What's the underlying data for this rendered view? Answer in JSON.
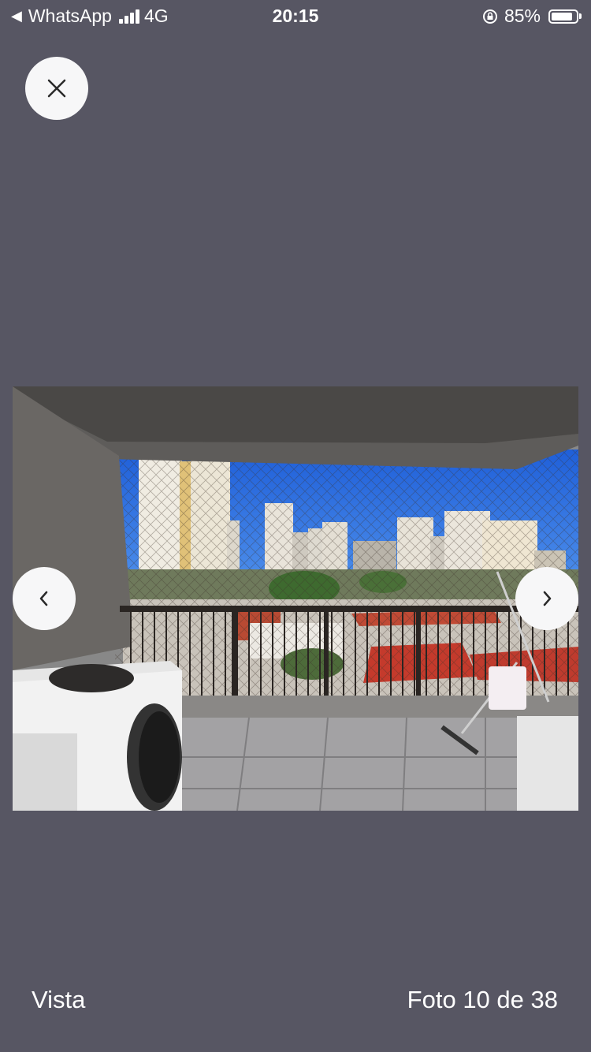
{
  "status_bar": {
    "back_app": "WhatsApp",
    "network": "4G",
    "time": "20:15",
    "battery_percent": "85%",
    "battery_level": 0.85
  },
  "viewer": {
    "photo_caption": "Vista",
    "photo_counter": "Foto 10 de 38"
  },
  "icons": {
    "close": "close-icon",
    "previous": "chevron-left-icon",
    "next": "chevron-right-icon"
  },
  "colors": {
    "background": "#575663",
    "button": "#f7f7f8",
    "icon": "#2a2a2a"
  }
}
